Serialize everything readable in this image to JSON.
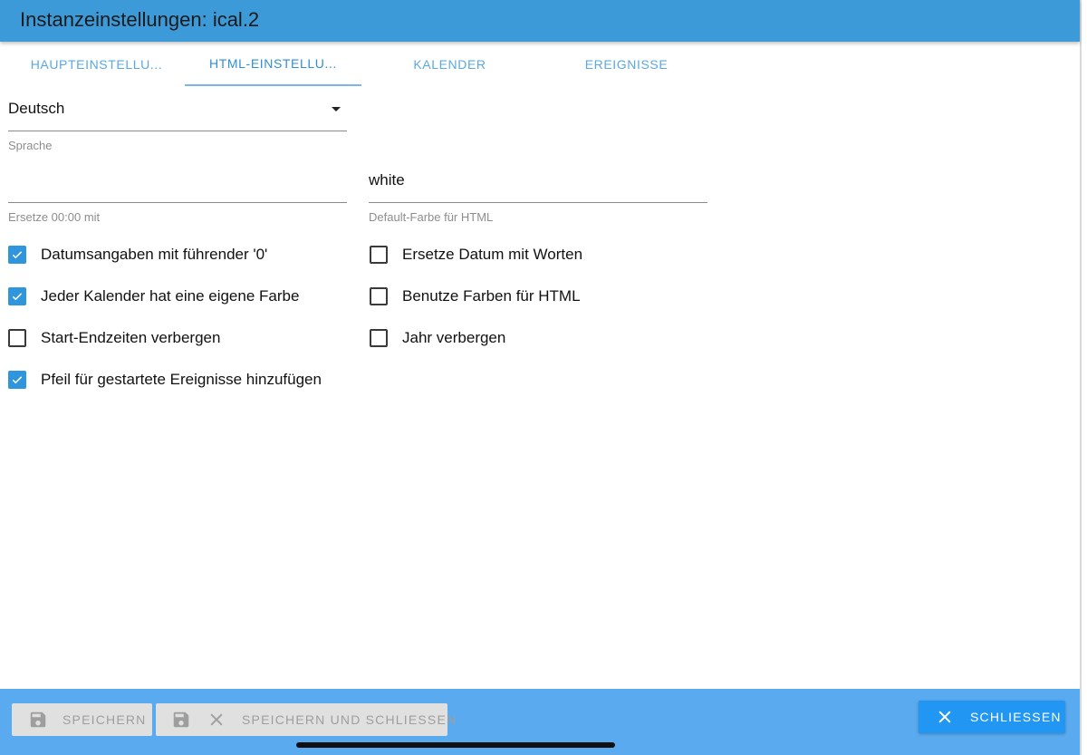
{
  "window": {
    "title": "Instanzeinstellungen: ical.2"
  },
  "tabs": [
    {
      "label": "HAUPTEINSTELLU...",
      "active": false
    },
    {
      "label": "HTML-EINSTELLU...",
      "active": true
    },
    {
      "label": "KALENDER",
      "active": false
    },
    {
      "label": "EREIGNISSE",
      "active": false
    }
  ],
  "fields": {
    "language": {
      "value": "Deutsch",
      "helper": "Sprache"
    },
    "replace_midnight": {
      "value": "",
      "helper": "Ersetze 00:00 mit"
    },
    "default_color": {
      "value": "white",
      "helper": "Default-Farbe für HTML"
    }
  },
  "checkboxes": {
    "leading_zero": {
      "label": "Datumsangaben mit führender '0'",
      "checked": true
    },
    "own_color": {
      "label": "Jeder Kalender hat eine eigene Farbe",
      "checked": true
    },
    "hide_times": {
      "label": "Start-Endzeiten verbergen",
      "checked": false
    },
    "arrow_started": {
      "label": "Pfeil für gestartete Ereignisse hinzufügen",
      "checked": true
    },
    "date_words": {
      "label": "Ersetze Datum mit Worten",
      "checked": false
    },
    "html_colors": {
      "label": "Benutze Farben für HTML",
      "checked": false
    },
    "hide_year": {
      "label": "Jahr verbergen",
      "checked": false
    }
  },
  "footer": {
    "save_label": "SPEICHERN",
    "save_close_label": "SPEICHERN UND SCHLIESSEN",
    "close_label": "SCHLIESSEN"
  },
  "icons": {
    "save": "save-icon",
    "close": "close-icon",
    "dropdown": "chevron-down-icon",
    "check": "check-icon"
  },
  "colors": {
    "appbar": "#3d9ad8",
    "footer": "#5aaaf0",
    "accent": "#2196f3",
    "checkbox": "#2f95dc"
  }
}
